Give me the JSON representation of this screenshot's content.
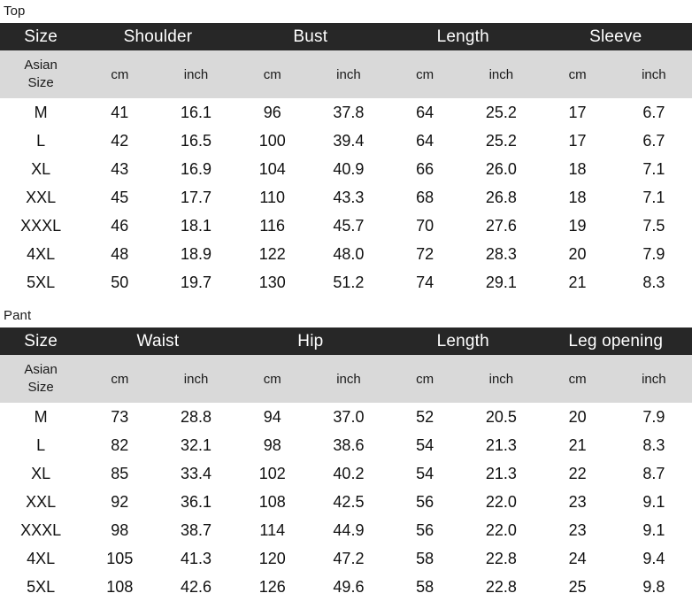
{
  "sections": [
    {
      "label": "Top",
      "size_header": "Size",
      "size_sub_line1": "Asian",
      "size_sub_line2": "Size",
      "groups": [
        "Shoulder",
        "Bust",
        "Length",
        "Sleeve"
      ],
      "units": [
        "cm",
        "inch",
        "cm",
        "inch",
        "cm",
        "inch",
        "cm",
        "inch"
      ],
      "rows": [
        {
          "size": "M",
          "values": [
            "41",
            "16.1",
            "96",
            "37.8",
            "64",
            "25.2",
            "17",
            "6.7"
          ]
        },
        {
          "size": "L",
          "values": [
            "42",
            "16.5",
            "100",
            "39.4",
            "64",
            "25.2",
            "17",
            "6.7"
          ]
        },
        {
          "size": "XL",
          "values": [
            "43",
            "16.9",
            "104",
            "40.9",
            "66",
            "26.0",
            "18",
            "7.1"
          ]
        },
        {
          "size": "XXL",
          "values": [
            "45",
            "17.7",
            "110",
            "43.3",
            "68",
            "26.8",
            "18",
            "7.1"
          ]
        },
        {
          "size": "XXXL",
          "values": [
            "46",
            "18.1",
            "116",
            "45.7",
            "70",
            "27.6",
            "19",
            "7.5"
          ]
        },
        {
          "size": "4XL",
          "values": [
            "48",
            "18.9",
            "122",
            "48.0",
            "72",
            "28.3",
            "20",
            "7.9"
          ]
        },
        {
          "size": "5XL",
          "values": [
            "50",
            "19.7",
            "130",
            "51.2",
            "74",
            "29.1",
            "21",
            "8.3"
          ]
        }
      ]
    },
    {
      "label": "Pant",
      "size_header": "Size",
      "size_sub_line1": "Asian",
      "size_sub_line2": "Size",
      "groups": [
        "Waist",
        "Hip",
        "Length",
        "Leg opening"
      ],
      "units": [
        "cm",
        "inch",
        "cm",
        "inch",
        "cm",
        "inch",
        "cm",
        "inch"
      ],
      "rows": [
        {
          "size": "M",
          "values": [
            "73",
            "28.8",
            "94",
            "37.0",
            "52",
            "20.5",
            "20",
            "7.9"
          ]
        },
        {
          "size": "L",
          "values": [
            "82",
            "32.1",
            "98",
            "38.6",
            "54",
            "21.3",
            "21",
            "8.3"
          ]
        },
        {
          "size": "XL",
          "values": [
            "85",
            "33.4",
            "102",
            "40.2",
            "54",
            "21.3",
            "22",
            "8.7"
          ]
        },
        {
          "size": "XXL",
          "values": [
            "92",
            "36.1",
            "108",
            "42.5",
            "56",
            "22.0",
            "23",
            "9.1"
          ]
        },
        {
          "size": "XXXL",
          "values": [
            "98",
            "38.7",
            "114",
            "44.9",
            "56",
            "22.0",
            "23",
            "9.1"
          ]
        },
        {
          "size": "4XL",
          "values": [
            "105",
            "41.3",
            "120",
            "47.2",
            "58",
            "22.8",
            "24",
            "9.4"
          ]
        },
        {
          "size": "5XL",
          "values": [
            "108",
            "42.6",
            "126",
            "49.6",
            "58",
            "22.8",
            "25",
            "9.8"
          ]
        }
      ]
    }
  ],
  "colors": {
    "header_band": "#272727",
    "unit_band": "#d9d9d9",
    "body": "#ffffff",
    "text": "#111111",
    "header_text": "#ffffff"
  }
}
